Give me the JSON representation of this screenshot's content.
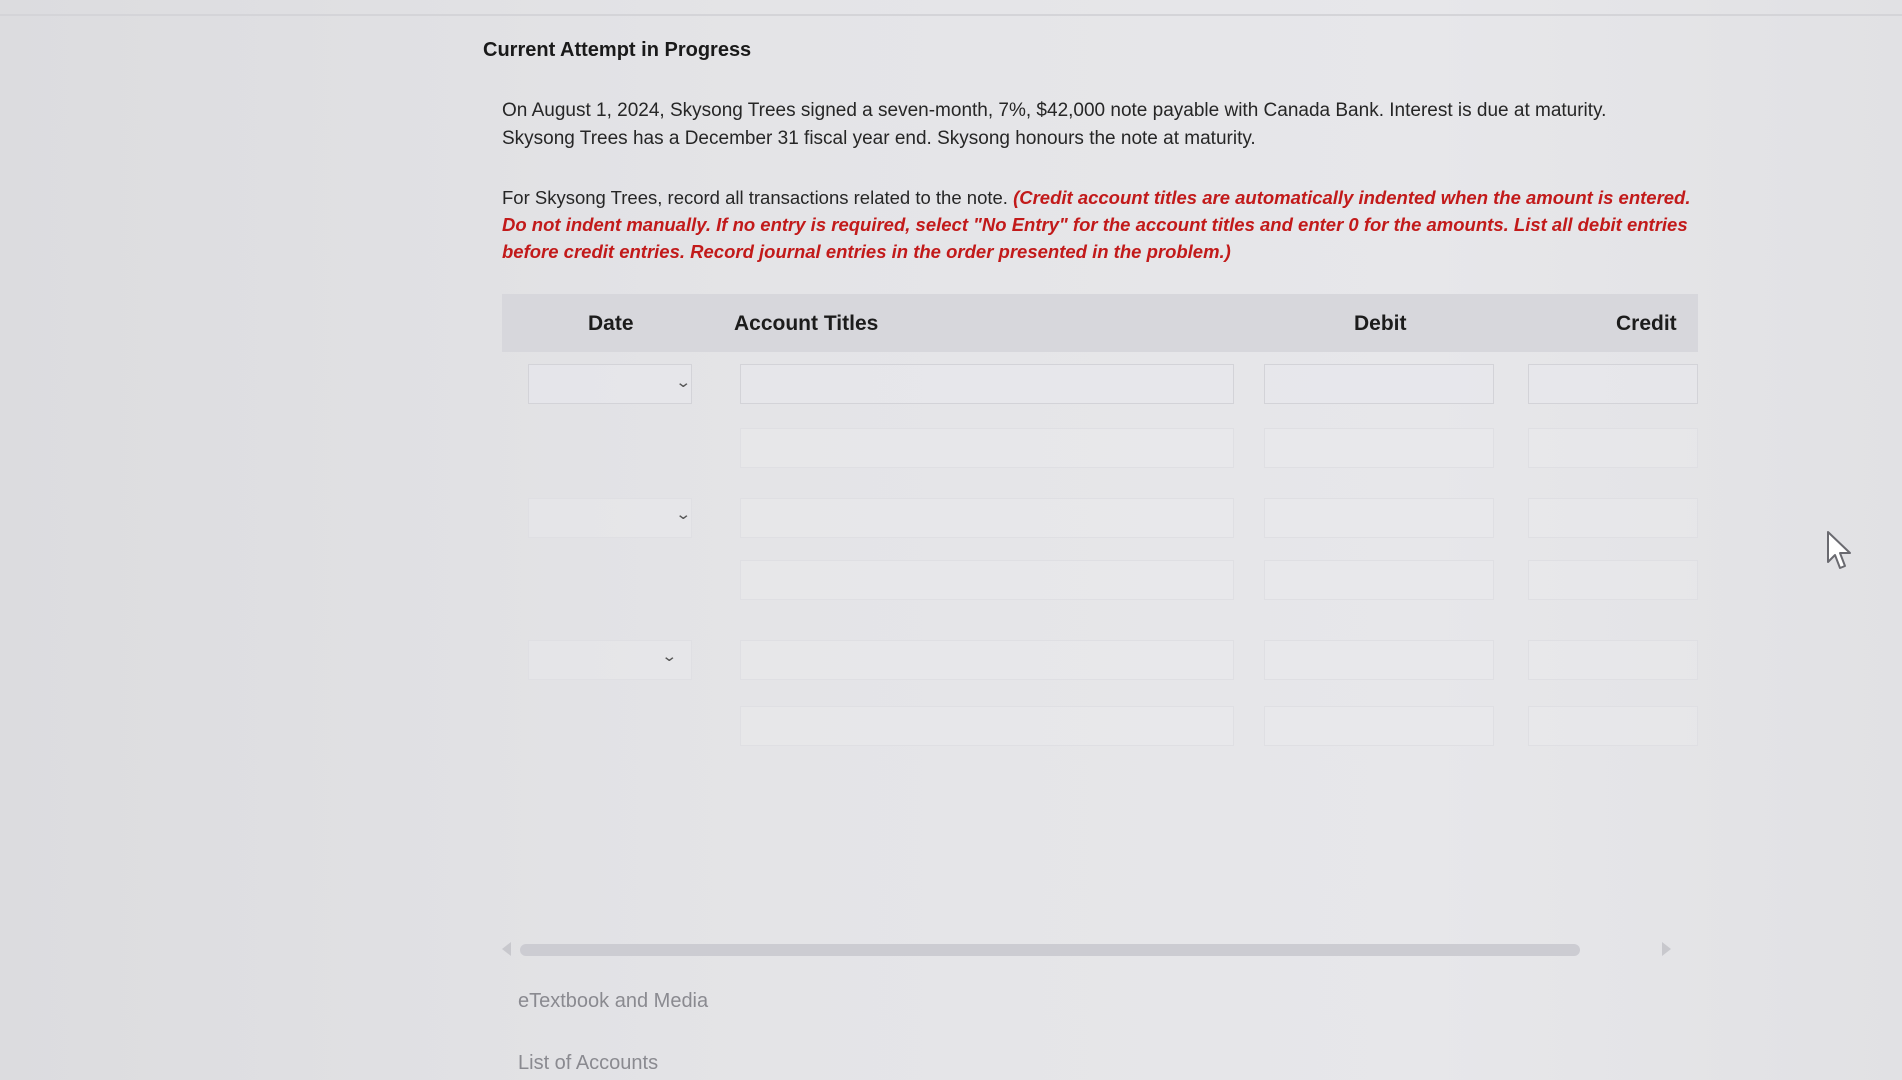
{
  "attempt_title": "Current Attempt in Progress",
  "problem_text": "On August 1, 2024, Skysong Trees signed a seven-month, 7%, $42,000 note payable with Canada Bank. Interest is due at maturity. Skysong Trees has a December 31 fiscal year end. Skysong honours the note at maturity.",
  "instructions": {
    "lead": "For Skysong Trees, record all transactions related to the note. ",
    "red": "(Credit account titles are automatically indented when the amount is entered. Do not indent manually. If no entry is required, select \"No Entry\" for the account titles and enter 0 for the amounts. List all debit entries before credit entries. Record journal entries in the order presented in the problem.)"
  },
  "journal": {
    "headers": {
      "date": "Date",
      "account_titles": "Account Titles",
      "debit": "Debit",
      "credit": "Credit"
    }
  },
  "links": {
    "etextbook": "eTextbook and Media",
    "list_of_accounts": "List of Accounts"
  },
  "icons": {
    "dropdown": "chevron-down-icon",
    "cursor": "mouse-pointer-icon"
  }
}
